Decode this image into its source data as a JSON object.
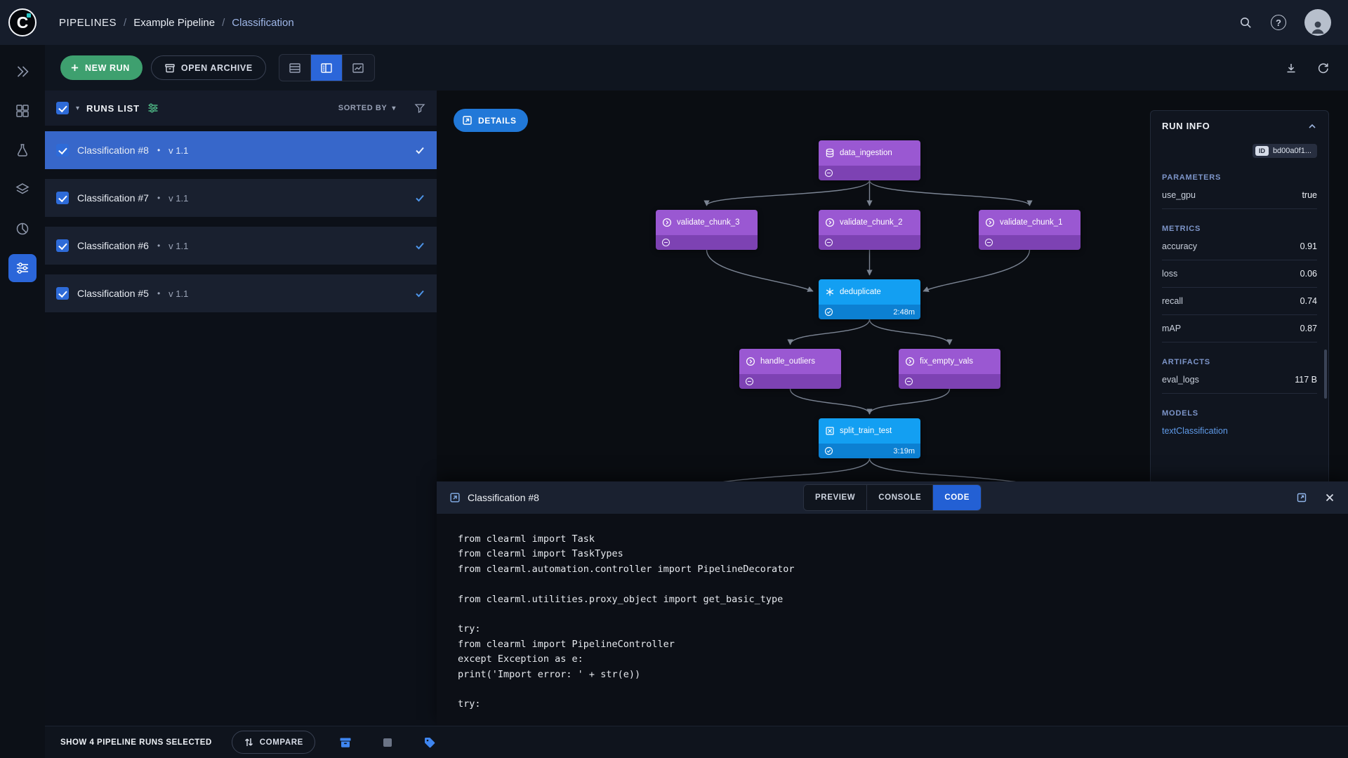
{
  "colors": {
    "accent_blue": "#2b66d9",
    "accent_green": "#3ea06f",
    "node_purple": "#9a58d2",
    "node_blue": "#139ff2",
    "selected_row": "#3767ca"
  },
  "ui": {
    "bullet": "•",
    "caret": "▾",
    "help_glyph": "?"
  },
  "header": {
    "breadcrumb": {
      "root": "PIPELINES",
      "sep": "/",
      "project": "Example Pipeline",
      "current": "Classification"
    }
  },
  "toolbar": {
    "new_run_label": "NEW RUN",
    "open_archive_label": "OPEN ARCHIVE"
  },
  "runs_list": {
    "title": "RUNS LIST",
    "sorted_by_label": "SORTED BY",
    "items": [
      {
        "name": "Classification #8",
        "version": "v 1.1",
        "selected": true
      },
      {
        "name": "Classification #7",
        "version": "v 1.1",
        "selected": false
      },
      {
        "name": "Classification #6",
        "version": "v 1.1",
        "selected": false
      },
      {
        "name": "Classification #5",
        "version": "v 1.1",
        "selected": false
      }
    ]
  },
  "graph": {
    "details_label": "DETAILS",
    "nodes": [
      {
        "label": "data_ingestion",
        "status": "pending"
      },
      {
        "label": "validate_chunk_3",
        "status": "pending"
      },
      {
        "label": "validate_chunk_2",
        "status": "pending"
      },
      {
        "label": "validate_chunk_1",
        "status": "pending"
      },
      {
        "label": "deduplicate",
        "status": "completed",
        "time": "2:48m"
      },
      {
        "label": "handle_outliers",
        "status": "pending"
      },
      {
        "label": "fix_empty_vals",
        "status": "pending"
      },
      {
        "label": "split_train_test",
        "status": "completed",
        "time": "3:19m"
      }
    ]
  },
  "run_info": {
    "title": "RUN INFO",
    "id_badge": "ID",
    "id_value": "bd00a0f1...",
    "sections": {
      "parameters_title": "PARAMETERS",
      "metrics_title": "METRICS",
      "artifacts_title": "ARTIFACTS",
      "models_title": "MODELS"
    },
    "parameters": [
      {
        "key": "use_gpu",
        "value": "true"
      }
    ],
    "metrics": [
      {
        "key": "accuracy",
        "value": "0.91"
      },
      {
        "key": "loss",
        "value": "0.06"
      },
      {
        "key": "recall",
        "value": "0.74"
      },
      {
        "key": "mAP",
        "value": "0.87"
      }
    ],
    "artifacts": [
      {
        "key": "eval_logs",
        "value": "117 B"
      }
    ],
    "models": [
      {
        "name": "textClassification"
      }
    ]
  },
  "bottom_panel": {
    "title": "Classification #8",
    "tabs": [
      {
        "label": "PREVIEW"
      },
      {
        "label": "CONSOLE"
      },
      {
        "label": "CODE"
      }
    ],
    "active_tab": "CODE",
    "code_lines": [
      "from clearml import Task",
      "from clearml import TaskTypes",
      "from clearml.automation.controller import PipelineDecorator",
      "",
      "from clearml.utilities.proxy_object import get_basic_type",
      "",
      "try:",
      "from clearml import PipelineController",
      "except Exception as e:",
      "print('Import error: ' + str(e))",
      "",
      "try:"
    ]
  },
  "footer": {
    "selection_label": "SHOW 4 PIPELINE RUNS SELECTED",
    "compare_label": "COMPARE"
  }
}
